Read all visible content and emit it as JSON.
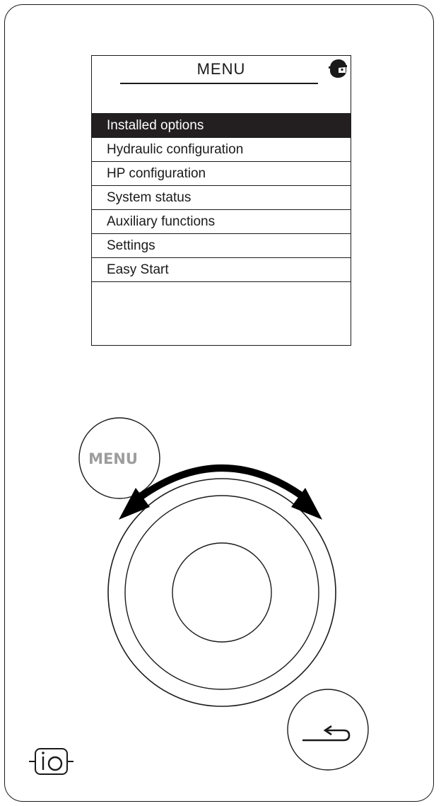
{
  "screen": {
    "title": "MENU",
    "user_icon": "user-profile-icon",
    "items": [
      {
        "label": "Installed options",
        "selected": true
      },
      {
        "label": "Hydraulic configuration",
        "selected": false
      },
      {
        "label": "HP configuration",
        "selected": false
      },
      {
        "label": "System status",
        "selected": false
      },
      {
        "label": "Auxiliary functions",
        "selected": false
      },
      {
        "label": "Settings",
        "selected": false
      },
      {
        "label": "Easy Start",
        "selected": false
      },
      {
        "label": "",
        "selected": false
      }
    ]
  },
  "controls": {
    "menu_button_label": "MENU",
    "rotary_arrows_icon": "rotate-both-ways-icon",
    "back_icon": "return-arrow-icon",
    "io_logo_label": "io"
  },
  "colors": {
    "outline": "#1a1a1a",
    "selected_bg": "#231f20",
    "selected_text": "#ffffff",
    "menu_button_text": "#9d9d9d"
  }
}
